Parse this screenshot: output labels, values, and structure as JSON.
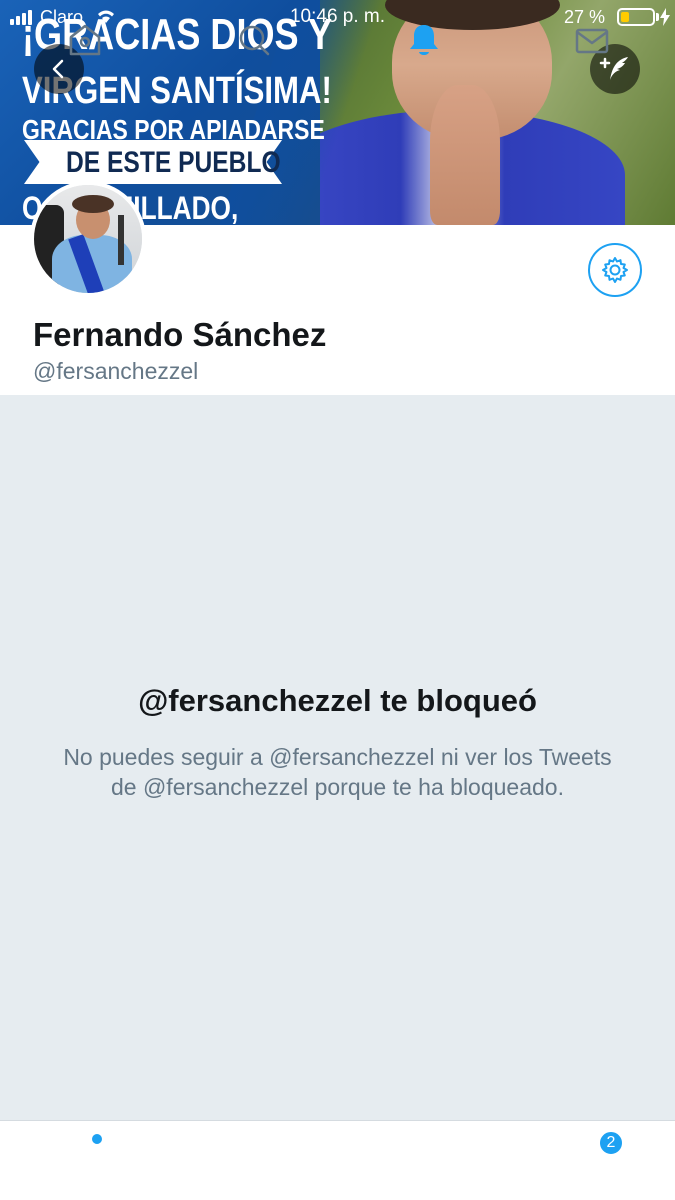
{
  "status_bar": {
    "carrier": "Claro",
    "time": "10:46 p. m.",
    "battery_percent": "27 %",
    "battery_level": 0.27
  },
  "banner": {
    "lines": [
      "¡GRACIAS DIOS Y",
      "VIRGEN SANTÍSIMA!",
      "GRACIAS POR APIADARSE",
      "DE ESTE PUEBLO",
      "O        Y HUMILLADO,"
    ]
  },
  "profile": {
    "name": "Fernando Sánchez",
    "handle": "@fersanchezzel"
  },
  "blocked": {
    "title": "@fersanchezzel te bloqueó",
    "message": "No puedes seguir a @fersanchezzel ni ver los Tweets de @fersanchezzel porque te ha bloqueado."
  },
  "tabbar": {
    "messages_badge": "2"
  },
  "colors": {
    "accent": "#1da1f2",
    "background_gray": "#e6ecf0",
    "text_primary": "#14171a",
    "text_secondary": "#657786"
  },
  "icons": {
    "back": "chevron-left-icon",
    "compose": "compose-tweet-icon",
    "settings": "gear-icon",
    "home": "home-icon",
    "search": "search-icon",
    "notifications": "bell-icon",
    "messages": "envelope-icon"
  }
}
